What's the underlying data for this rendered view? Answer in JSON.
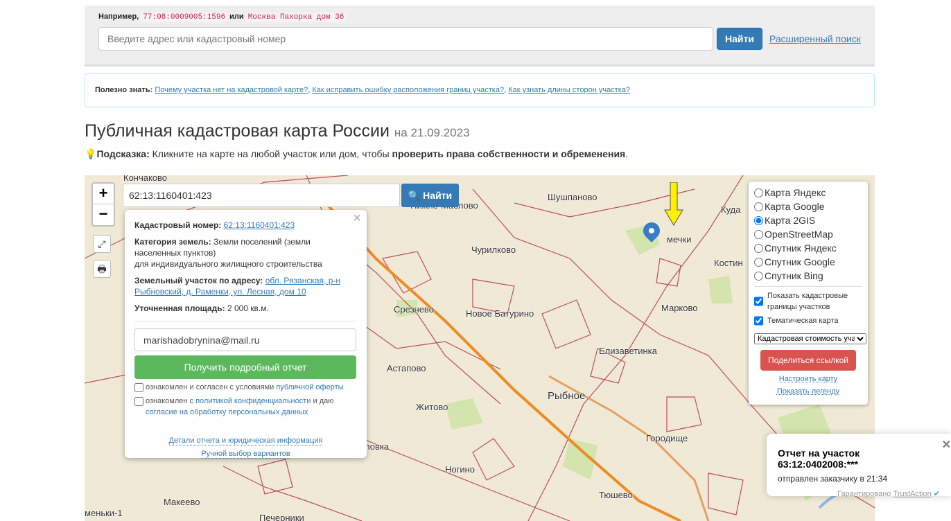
{
  "search": {
    "example_prefix": "Например,",
    "example1": "77:08:0009005:1596",
    "or": "или",
    "example2": "Москва Пахорка дом 36",
    "placeholder": "Введите адрес или кадастровый номер",
    "find": "Найти",
    "advanced": "Расширенный поиск"
  },
  "tips": {
    "label": "Полезно знать:",
    "links": [
      "Почему участка нет на кадастровой карте?",
      "Как исправить ошибку расположения границ участка?",
      "Как узнать длины сторон участка?"
    ]
  },
  "title": "Публичная кадастровая карта России",
  "date": "на 21.09.2023",
  "hint": {
    "label": "Подсказка:",
    "text": "Кликните на карте на любой участок или дом, чтобы",
    "bold": "проверить права собственности и обременения",
    "end": "."
  },
  "map": {
    "cad_input": "62:13:1160401:423",
    "find": "Найти",
    "zoom_in": "+",
    "zoom_out": "−",
    "labels": [
      "Кончаково",
      "Нижне-Маслово",
      "Шушпаново",
      "Куда",
      "Чурилково",
      "мечки",
      "Костин",
      "Марково",
      "Срезнево",
      "Новое Батурино",
      "Елизаветинка",
      "Астапово",
      "Рыбное",
      "Житово",
      "Городище",
      "ловка",
      "Ногино",
      "Макеево",
      "Тюшево",
      "Печерники",
      "меньки-1"
    ],
    "popup": {
      "cad_label": "Кадастровый номер:",
      "cad_value": "62:13:1160401:423",
      "cat_label": "Категория земель:",
      "cat_value": "Земли поселений (земли населенных пунктов)",
      "use": "для индивидуального жилищного строительства",
      "addr_label": "Земельный участок по адресу:",
      "addr_value": "обл. Рязанская, р-н Рыбновский, д. Раменки, ул. Лесная, дом 10",
      "area_label": "Уточненная площадь:",
      "area_value": "2 000 кв.м.",
      "email": "marishadobrynina@mail.ru",
      "get_report": "Получить подробный отчет",
      "agree1": "ознакомлен и согласен с условиями",
      "agree1_link": "публичной оферты",
      "agree2": "ознакомлен с",
      "agree2_link": "политикой конфиденциальности",
      "agree2_mid": "и даю",
      "agree2_link2": "согласие на обработку персональных данных",
      "details": "Детали отчета и юридическая информация",
      "manual": "Ручной выбор вариантов"
    },
    "layers": {
      "options": [
        "Карта Яндекс",
        "Карта Google",
        "Карта 2GIS",
        "OpenStreetMap",
        "Спутник Яндекс",
        "Спутник Google",
        "Спутник Bing"
      ],
      "selected": "Карта 2GIS",
      "show_borders": "Показать кадастровые границы участков",
      "thematic": "Тематическая карта",
      "select_value": "Кадастровая стоимость участков",
      "share": "Поделиться ссылкой",
      "configure": "Настроить карту",
      "legend": "Показать легенду"
    }
  },
  "toast": {
    "title": "Отчет на участок 63:12:0402008:***",
    "sub": "отправлен заказчику в 21:34",
    "guarantee": "Гарантировано",
    "brand": "TrustAction"
  }
}
